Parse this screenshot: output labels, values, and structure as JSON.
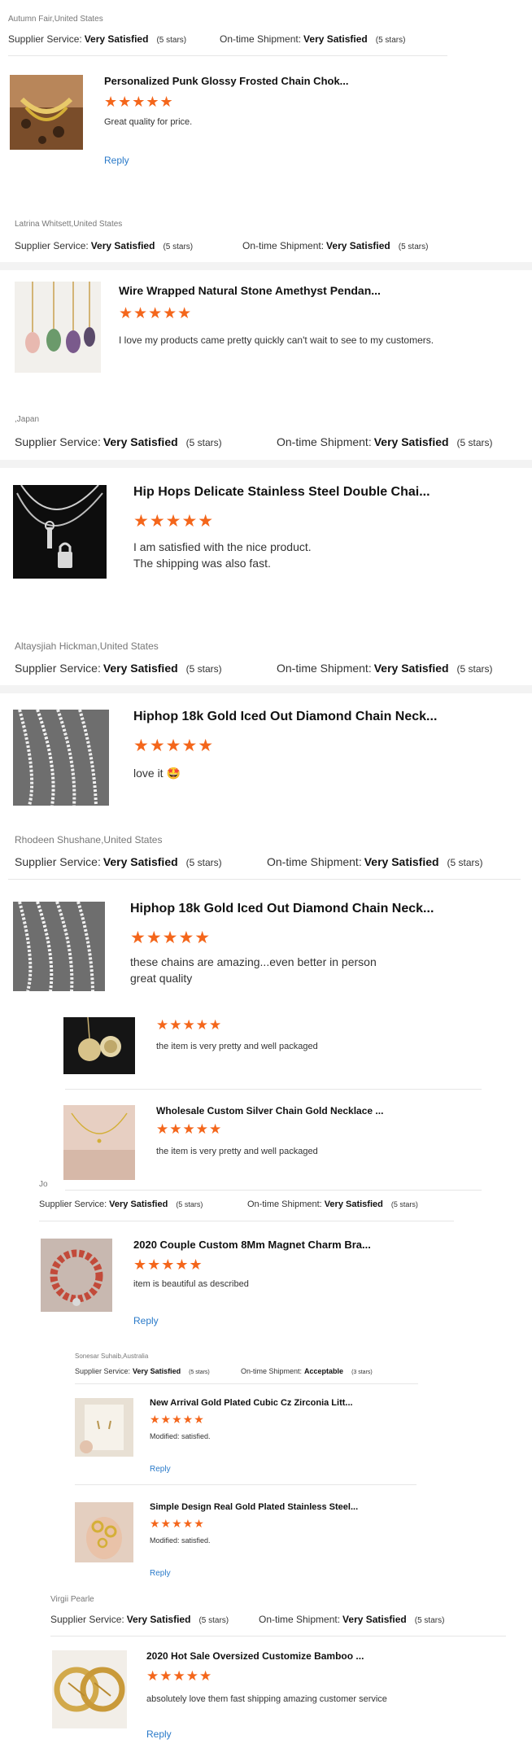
{
  "star_glyphs": "★★★★★",
  "colors": {
    "star": "#f4661b",
    "reply": "#2a7ac9"
  },
  "block1": {
    "reviewer": "Autumn Fair,United States",
    "supplier_label": "Supplier Service:",
    "supplier_value": "Very Satisfied",
    "supplier_count": "(5 stars)",
    "shipment_label": "On-time Shipment:",
    "shipment_value": "Very Satisfied",
    "shipment_count": "(5 stars)",
    "item": {
      "title": "Personalized Punk Glossy Frosted Chain Chok...",
      "rating": 5,
      "text": "Great quality for price.",
      "reply": "Reply",
      "image_icon": "gold-chain-necklace-photo"
    }
  },
  "block2": {
    "reviewer": "Latrina Whitsett,United States",
    "supplier_label": "Supplier Service:",
    "supplier_value": "Very Satisfied",
    "supplier_count": "(5 stars)",
    "shipment_label": "On-time Shipment:",
    "shipment_value": "Very Satisfied",
    "shipment_count": "(5 stars)",
    "item": {
      "title": "Wire Wrapped Natural Stone Amethyst Pendan...",
      "rating": 5,
      "text": "I love my products came pretty quickly can't wait to see to my customers.",
      "image_icon": "stone-pendants-photo"
    }
  },
  "block3": {
    "reviewer": ",Japan",
    "supplier_label": "Supplier Service:",
    "supplier_value": "Very Satisfied",
    "supplier_count": "(5 stars)",
    "shipment_label": "On-time Shipment:",
    "shipment_value": "Very Satisfied",
    "shipment_count": "(5 stars)",
    "item": {
      "title": "Hip Hops Delicate Stainless Steel Double Chai...",
      "rating": 5,
      "text_line1": "I am satisfied with the nice product.",
      "text_line2": "The shipping was also fast.",
      "image_icon": "lock-key-necklace-photo"
    }
  },
  "block4": {
    "reviewer": "Altaysjiah Hickman,United States",
    "supplier_label": "Supplier Service:",
    "supplier_value": "Very Satisfied",
    "supplier_count": "(5 stars)",
    "shipment_label": "On-time Shipment:",
    "shipment_value": "Very Satisfied",
    "shipment_count": "(5 stars)",
    "item": {
      "title": "Hiphop 18k Gold Iced Out Diamond Chain Neck...",
      "rating": 5,
      "text": "love it",
      "emoji": "🤩",
      "image_icon": "iced-chain-photo"
    }
  },
  "block5": {
    "reviewer": "Rhodeen Shushane,United States",
    "supplier_label": "Supplier Service:",
    "supplier_value": "Very Satisfied",
    "supplier_count": "(5 stars)",
    "shipment_label": "On-time Shipment:",
    "shipment_value": "Very Satisfied",
    "shipment_count": "(5 stars)",
    "item": {
      "title": "Hiphop 18k Gold Iced Out Diamond Chain Neck...",
      "rating": 5,
      "text_line1": "these chains are amazing...even better in person",
      "text_line2": "great quality",
      "image_icon": "iced-chain-photo"
    }
  },
  "block6": {
    "reviewer": "Jo",
    "supplier_label": "Supplier Service:",
    "supplier_value": "Very Satisfied",
    "supplier_count": "(5 stars)",
    "shipment_label": "On-time Shipment:",
    "shipment_value": "Very Satisfied",
    "shipment_count": "(5 stars)",
    "items": [
      {
        "title": "",
        "rating": 5,
        "text": "the item is very pretty and well packaged",
        "image_icon": "locket-photo"
      },
      {
        "title": "Wholesale Custom Silver Chain Gold Necklace ...",
        "rating": 5,
        "text": "the item is very pretty and well packaged",
        "image_icon": "gold-necklace-photo"
      }
    ]
  },
  "block7": {
    "reviewer": "Sonesar Suhaib,Australia",
    "supplier_label": "Supplier Service:",
    "supplier_value": "Very Satisfied",
    "supplier_count": "(5 stars)",
    "shipment_label": "On-time Shipment:",
    "shipment_value": "Acceptable",
    "shipment_count": "(3 stars)",
    "item": {
      "title": "2020 Couple Custom 8Mm Magnet Charm Bra...",
      "rating": 5,
      "text": "item is beautiful as described",
      "reply": "Reply",
      "image_icon": "bead-bracelet-photo"
    }
  },
  "block8": {
    "reviewer": "Virgii Pearle",
    "supplier_label": "Supplier Service:",
    "supplier_value": "Very Satisfied",
    "supplier_count": "(5 stars)",
    "shipment_label": "On-time Shipment:",
    "shipment_value": "Very Satisfied",
    "shipment_count": "(5 stars)",
    "items": [
      {
        "title": "New Arrival Gold Plated Cubic Cz Zirconia Litt...",
        "rating": 5,
        "text": "Modified: satisfied.",
        "reply": "Reply",
        "image_icon": "earring-card-photo"
      },
      {
        "title": "Simple Design Real Gold Plated Stainless Steel...",
        "rating": 5,
        "text": "Modified: satisfied.",
        "reply": "Reply",
        "image_icon": "gold-rings-hand-photo"
      }
    ]
  },
  "block9": {
    "item": {
      "title": "2020 Hot Sale Oversized Customize Bamboo ...",
      "rating": 5,
      "text": "absolutely love them fast shipping amazing customer service",
      "reply": "Reply",
      "image_icon": "bamboo-earrings-photo"
    }
  }
}
